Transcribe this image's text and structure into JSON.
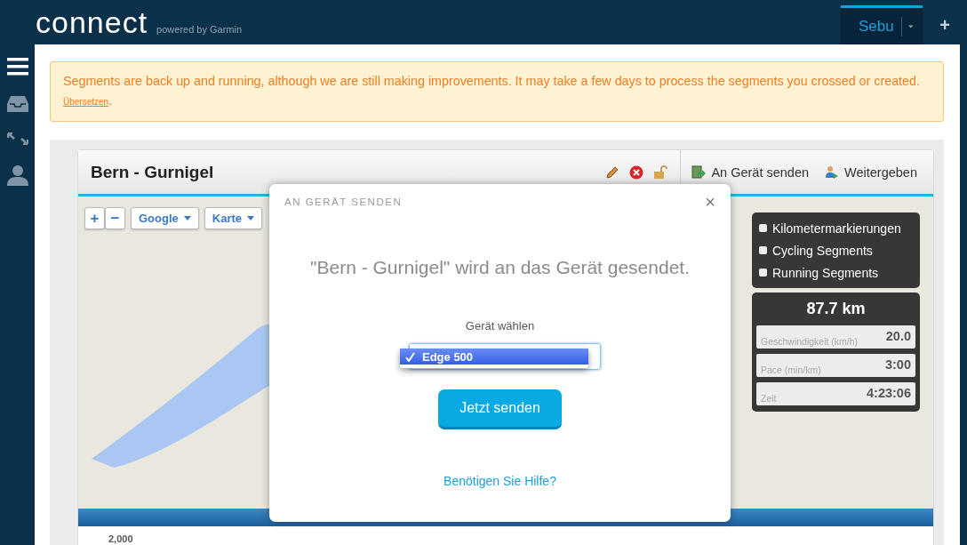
{
  "header": {
    "logo": "connect",
    "tagline": "powered by Garmin",
    "user_tab": {
      "label": "Sebu",
      "selected": true
    },
    "add_button": "+"
  },
  "banner": {
    "text": "Segments are back up and running, although we are still making improvements. It may take a few days to process the segments you crossed or created.",
    "link": "Übersetzen",
    "suffix": "."
  },
  "course": {
    "title": "Bern - Gurnigel",
    "actions": [
      {
        "kind": "send",
        "label": "An Gerät senden"
      },
      {
        "kind": "share",
        "label": "Weitergeben"
      }
    ]
  },
  "map_controls": {
    "zoom_in": "+",
    "zoom_out": "−",
    "provider": "Google",
    "map_type": "Karte"
  },
  "layers": [
    {
      "label": "Kilometermarkierungen",
      "checked": false
    },
    {
      "label": "Cycling Segments",
      "checked": false
    },
    {
      "label": "Running Segments",
      "checked": false
    }
  ],
  "stats": {
    "distance": "87.7 km",
    "rows": [
      {
        "label": "Geschwindigkeit (km/h)",
        "value": "20.0"
      },
      {
        "label": "Pace (min/km)",
        "value": "3:00"
      },
      {
        "label": "Zeit",
        "value": "4:23:06"
      }
    ]
  },
  "dialog": {
    "title": "AN GERÄT SENDEN",
    "close": "×",
    "message": "\"Bern - Gurnigel\" wird an das Gerät gesendet.",
    "select_label": "Gerät wählen",
    "options": [
      {
        "label": "Edge 500",
        "selected": true
      }
    ],
    "submit": "Jetzt senden",
    "help_link": "Benötigen Sie Hilfe?"
  },
  "chart": {
    "y_tick": "2,000"
  }
}
